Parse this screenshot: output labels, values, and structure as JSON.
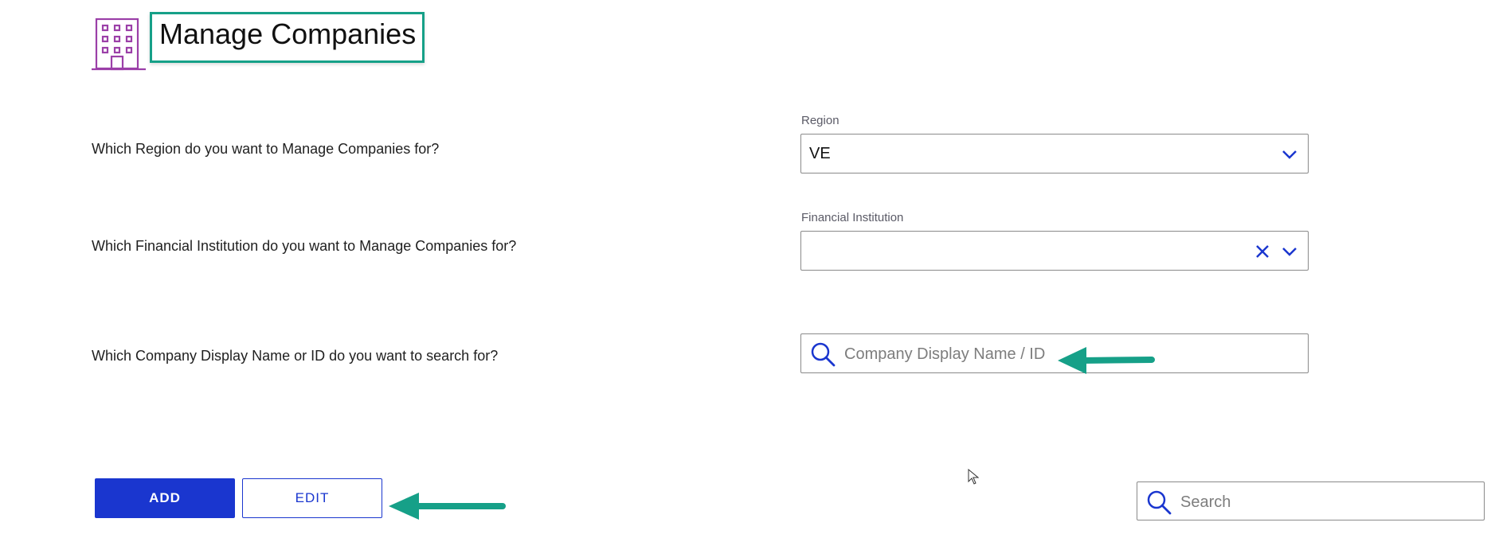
{
  "header": {
    "title": "Manage Companies",
    "icon": "building-icon"
  },
  "region": {
    "question": "Which Region do you want to Manage Companies for?",
    "label": "Region",
    "value": "VE"
  },
  "institution": {
    "question": "Which Financial Institution do you want to Manage Companies for?",
    "label": "Financial Institution",
    "value": ""
  },
  "company_search": {
    "question": "Which Company Display Name or ID do you want to search for?",
    "placeholder": "Company Display Name / ID"
  },
  "actions": {
    "add_label": "ADD",
    "edit_label": "EDIT"
  },
  "table_search": {
    "placeholder": "Search"
  },
  "colors": {
    "primary": "#1a36cf",
    "annotation": "#16a088",
    "icon_purple": "#9b3fa8"
  }
}
